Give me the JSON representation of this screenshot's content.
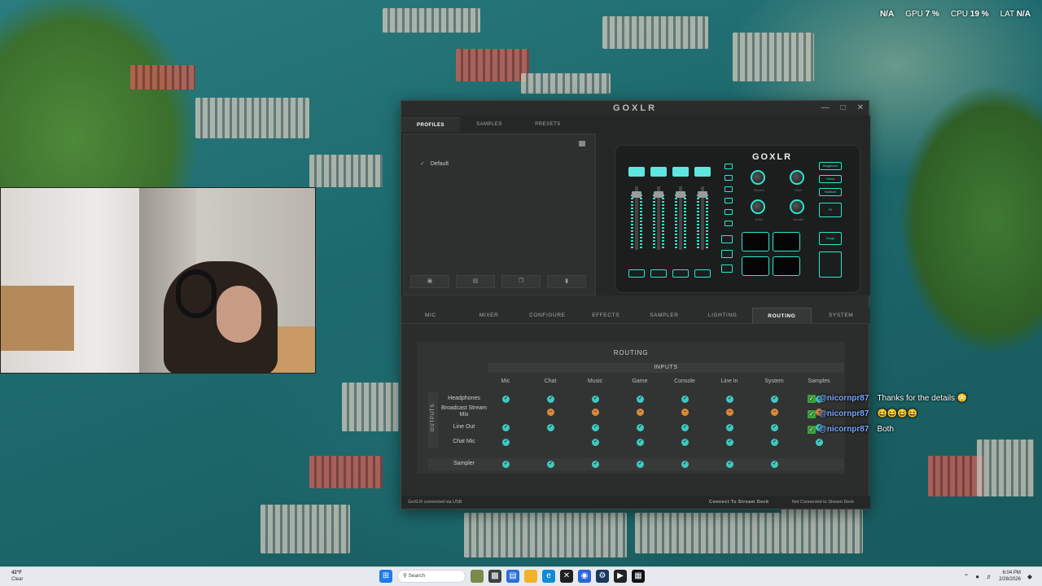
{
  "overlay": {
    "net": "N/A",
    "gpu_label": "GPU",
    "gpu": "7 %",
    "cpu_label": "CPU",
    "cpu": "19 %",
    "lat_label": "LAT",
    "lat": "N/A"
  },
  "app": {
    "title": "GOXLR",
    "profile_tabs": [
      "PROFILES",
      "SAMPLES",
      "PRESETS"
    ],
    "profile_items": [
      {
        "label": "Default",
        "selected": true
      }
    ],
    "device_logo": "GOXLR",
    "device_right_buttons": [
      "Megaphone",
      "Robot",
      "Hardtune",
      "FX",
      "Cough",
      ""
    ],
    "device_dial_labels": [
      "Reverb",
      "Pitch",
      "Echo",
      "Gender"
    ],
    "nav_tabs": [
      "MIC",
      "MIXER",
      "CONFIGURE",
      "EFFECTS",
      "SAMPLER",
      "LIGHTING",
      "ROUTING",
      "SYSTEM"
    ],
    "active_tab": "ROUTING",
    "routing": {
      "title": "ROUTING",
      "inputs_label": "INPUTS",
      "outputs_label": "OUTPUTS",
      "columns": [
        "Mic",
        "Chat",
        "Music",
        "Game",
        "Console",
        "Line In",
        "System",
        "Samples"
      ],
      "rows": [
        {
          "label": "Headphones",
          "cells": [
            "on",
            "on",
            "on",
            "on",
            "on",
            "on",
            "on",
            "on"
          ]
        },
        {
          "label": "Broadcast Stream Mix",
          "cells": [
            "",
            "partial",
            "partial",
            "partial",
            "partial",
            "partial",
            "partial",
            "partial"
          ]
        },
        {
          "label": "Line Out",
          "cells": [
            "on",
            "on",
            "on",
            "on",
            "on",
            "on",
            "on",
            "on"
          ]
        },
        {
          "label": "Chat Mic",
          "cells": [
            "on",
            "",
            "on",
            "on",
            "on",
            "on",
            "on",
            "on"
          ]
        }
      ],
      "sampler_row": {
        "label": "Sampler",
        "cells": [
          "on",
          "on",
          "on",
          "on",
          "on",
          "on",
          "on",
          ""
        ]
      }
    },
    "status": {
      "left": "GoXLR connected via USB",
      "mid": "Connect To Stream Deck",
      "right": "Not Connected to Stream Deck"
    }
  },
  "chat": [
    {
      "user": "@nicornpr87",
      "message": "Thanks for the details 😳"
    },
    {
      "user": "@nicornpr87",
      "message": "😆😆😆😆"
    },
    {
      "user": "@nicornpr87",
      "message": "Both"
    }
  ],
  "taskbar": {
    "weather_temp": "42°F",
    "weather_desc": "Clear",
    "search_placeholder": "Search",
    "time": "6:04 PM",
    "date": "2/28/2026"
  },
  "colors": {
    "accent": "#2de6d0",
    "route_on": "#3fc9c2",
    "route_partial": "#d88a3a"
  }
}
